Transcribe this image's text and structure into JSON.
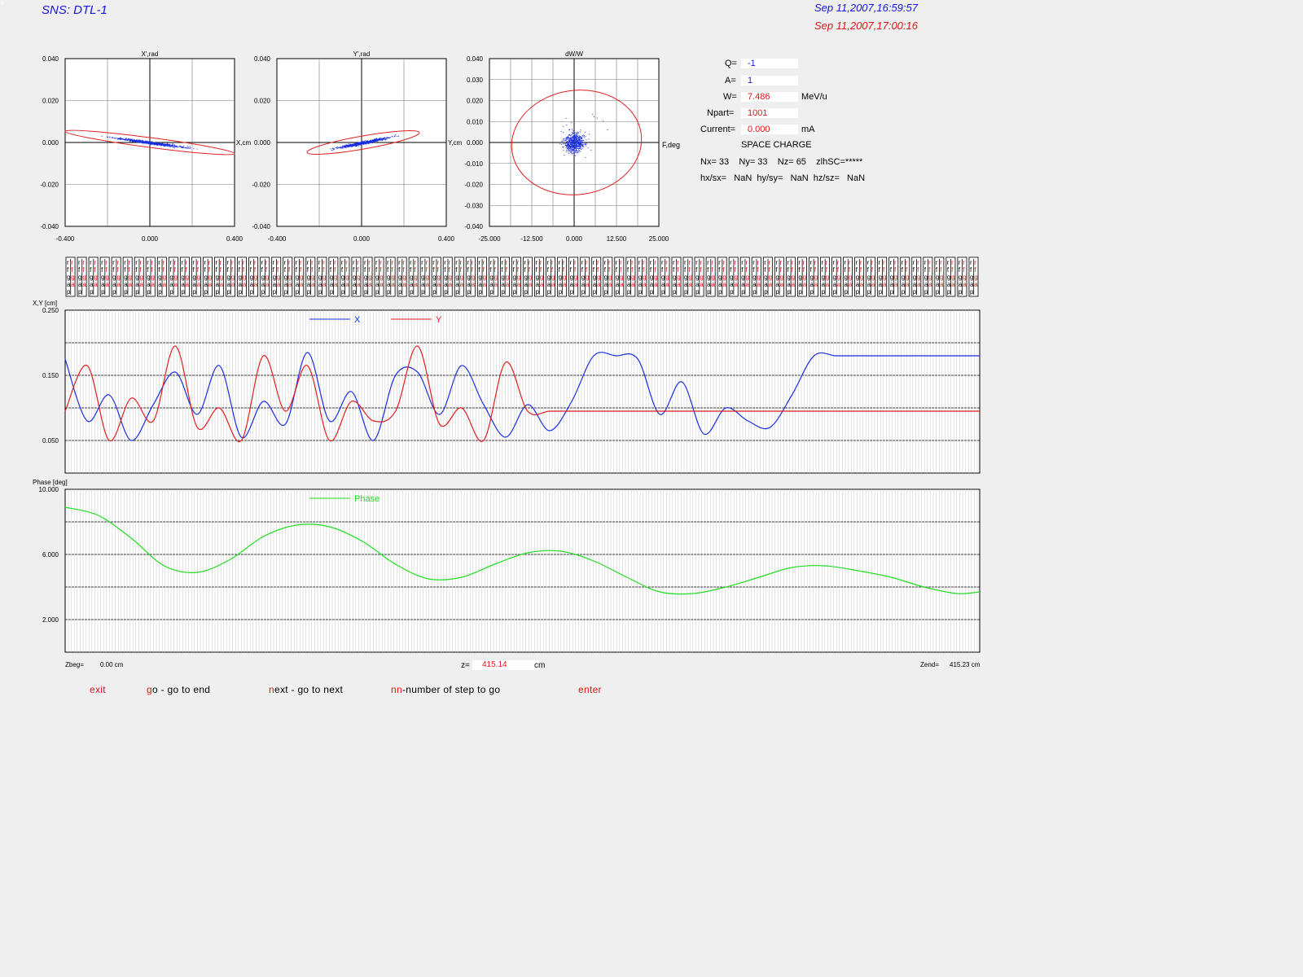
{
  "window": {
    "title": "SNS: DTL-1",
    "corner_mark": "8"
  },
  "timestamps": {
    "reference": "Sep 11,2007,16:59:57",
    "current": "Sep 11,2007,17:00:16"
  },
  "phase_plots": [
    {
      "title": "X',rad",
      "axis_label": "X,cm",
      "y_ticks": [
        "0.040",
        "0.020",
        "0.000",
        "-0.020",
        "-0.040"
      ],
      "x_ticks": [
        "-0.400",
        "0.000",
        "0.400"
      ]
    },
    {
      "title": "Y',rad",
      "axis_label": "Y,cm",
      "y_ticks": [
        "0.040",
        "0.020",
        "0.000",
        "-0.020",
        "-0.040"
      ],
      "x_ticks": [
        "-0.400",
        "0.000",
        "0.400"
      ]
    },
    {
      "title": "dW/W",
      "axis_label": "F,deg",
      "y_ticks": [
        "0.040",
        "0.030",
        "0.020",
        "0.010",
        "0.000",
        "-0.010",
        "-0.020",
        "-0.030",
        "-0.040"
      ],
      "x_ticks": [
        "-25.000",
        "-12.500",
        "0.000",
        "12.500",
        "25.000"
      ]
    }
  ],
  "params": {
    "q_label": "Q=",
    "q_value": "-1",
    "a_label": "A=",
    "a_value": "1",
    "w_label": "W=",
    "w_value": "7.486",
    "w_unit": "MeV/u",
    "npart_label": "Npart=",
    "npart_value": "1001",
    "current_label": "Current=",
    "current_value": "0.000",
    "current_unit": "mA",
    "space_charge": "SPACE CHARGE",
    "grid_line": "Nx= 33    Ny= 33    Nz= 65    zlhSC=*****",
    "ratio_line": "hx/sx=   NaN  hy/sy=   NaN  hz/sz=   NaN"
  },
  "element_strip": {
    "row_letters": [
      "r",
      "f",
      "g",
      "a",
      "p"
    ],
    "count": 80
  },
  "envelope_chart": {
    "ylabel": "X,Y [cm]",
    "y_ticks": [
      "0.250",
      "0.150",
      "0.050"
    ],
    "legend_x": "X",
    "legend_y": "Y",
    "colors": {
      "x": "#1a2ee0",
      "y": "#e02020"
    }
  },
  "phase_chart": {
    "ylabel": "Phase [deg]",
    "y_ticks": [
      "10.000",
      "6.000",
      "2.000"
    ],
    "legend": "Phase",
    "color": "#22dd22"
  },
  "chart_data": [
    {
      "type": "line",
      "title": "",
      "xlabel": "",
      "ylabel": "X,Y [cm]",
      "xlim": [
        0,
        415.23
      ],
      "ylim": [
        0.0,
        0.25
      ],
      "x": [
        0,
        10,
        20,
        30,
        40,
        50,
        60,
        70,
        80,
        90,
        100,
        110,
        120,
        130,
        140,
        150,
        160,
        170,
        180,
        190,
        200,
        210,
        220,
        230,
        240,
        250,
        260,
        270,
        280,
        290,
        300,
        310,
        320,
        330,
        340,
        350,
        360,
        370,
        380,
        390,
        400,
        415.23
      ],
      "series": [
        {
          "name": "X",
          "values": [
            0.175,
            0.08,
            0.12,
            0.05,
            0.105,
            0.155,
            0.09,
            0.165,
            0.055,
            0.11,
            0.075,
            0.185,
            0.08,
            0.125,
            0.05,
            0.15,
            0.155,
            0.09,
            0.165,
            0.105,
            0.055,
            0.105,
            0.065,
            0.11,
            0.18,
            0.18,
            0.175,
            0.09,
            0.14,
            0.06,
            0.1,
            0.08,
            0.07,
            0.12,
            0.18,
            0.18,
            0.18,
            0.18,
            0.18,
            0.18,
            0.18,
            0.18
          ]
        },
        {
          "name": "Y",
          "values": [
            0.095,
            0.165,
            0.05,
            0.115,
            0.08,
            0.195,
            0.07,
            0.1,
            0.05,
            0.18,
            0.095,
            0.165,
            0.05,
            0.11,
            0.08,
            0.095,
            0.195,
            0.075,
            0.1,
            0.05,
            0.17,
            0.095,
            0.095,
            0.095,
            0.095,
            0.095,
            0.095,
            0.095,
            0.095,
            0.095,
            0.095,
            0.095,
            0.095,
            0.095,
            0.095,
            0.095,
            0.095,
            0.095,
            0.095,
            0.095,
            0.095,
            0.095
          ]
        }
      ]
    },
    {
      "type": "line",
      "title": "",
      "xlabel": "",
      "ylabel": "Phase [deg]",
      "xlim": [
        0,
        415.23
      ],
      "ylim": [
        0.0,
        10.0
      ],
      "x": [
        0,
        15,
        30,
        45,
        60,
        75,
        90,
        105,
        120,
        135,
        150,
        165,
        180,
        195,
        210,
        225,
        240,
        255,
        270,
        285,
        300,
        315,
        330,
        345,
        360,
        375,
        390,
        405,
        415.23
      ],
      "series": [
        {
          "name": "Phase",
          "values": [
            8.9,
            8.4,
            7.0,
            5.3,
            4.9,
            5.7,
            7.1,
            7.8,
            7.7,
            6.8,
            5.4,
            4.5,
            4.6,
            5.4,
            6.1,
            6.2,
            5.6,
            4.6,
            3.7,
            3.6,
            4.0,
            4.6,
            5.2,
            5.3,
            5.0,
            4.6,
            4.0,
            3.6,
            3.7
          ]
        }
      ]
    }
  ],
  "zpos": {
    "zbeg_label": "Zbeg=",
    "zbeg_value": "0.00 cm",
    "z_label": "z=",
    "z_value": "415.14",
    "z_unit": "cm",
    "zend_label": "Zend=",
    "zend_value": "415.23 cm"
  },
  "menu": {
    "exit_key": "exit",
    "exit_rest": "",
    "go_key": "g",
    "go_rest": "o - go to end",
    "next_key": "n",
    "next_rest": "ext - go to next",
    "nn_key": "nn",
    "nn_rest": "-number of step to go",
    "enter_key": "enter"
  }
}
